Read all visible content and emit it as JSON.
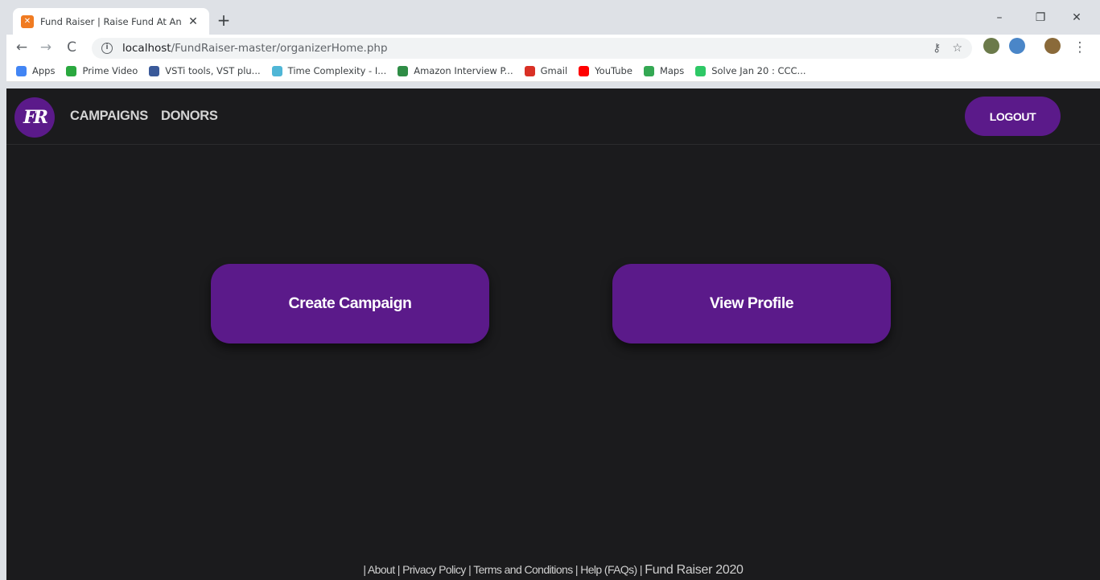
{
  "browser": {
    "tab_title": "Fund Raiser | Raise Fund At An Ea",
    "tab_favicon": "xampp-icon",
    "url_host": "localhost",
    "url_path": "/FundRaiser-master/organizerHome.php",
    "bookmarks": [
      {
        "label": "Apps",
        "icon": "apps-grid-icon",
        "color": "#4285f4"
      },
      {
        "label": "Prime Video",
        "icon": "prime-video-icon",
        "color": "#2aa83f"
      },
      {
        "label": "VSTi tools, VST plu...",
        "icon": "vsti-icon",
        "color": "#3a5a9a"
      },
      {
        "label": "Time Complexity - I...",
        "icon": "ib-icon",
        "color": "#4fb6d6"
      },
      {
        "label": "Amazon Interview P...",
        "icon": "gfg-icon",
        "color": "#2f8d46"
      },
      {
        "label": "Gmail",
        "icon": "gmail-icon",
        "color": "#d93025"
      },
      {
        "label": "YouTube",
        "icon": "youtube-icon",
        "color": "#ff0000"
      },
      {
        "label": "Maps",
        "icon": "maps-icon",
        "color": "#34a853"
      },
      {
        "label": "Solve Jan 20 : CCC...",
        "icon": "hackerrank-icon",
        "color": "#2ec866"
      }
    ]
  },
  "site": {
    "logo_text": "FR",
    "nav": {
      "campaigns": "CAMPAIGNS",
      "donors": "DONORS"
    },
    "logout": "LOGOUT",
    "create_campaign": "Create Campaign",
    "view_profile": "View Profile",
    "footer": {
      "links": "| About | Privacy Policy | Terms and Conditions | Help (FAQs) |",
      "brand": "Fund Raiser 2020"
    },
    "accent_color": "#5b1a8a",
    "background_color": "#1b1b1d"
  }
}
